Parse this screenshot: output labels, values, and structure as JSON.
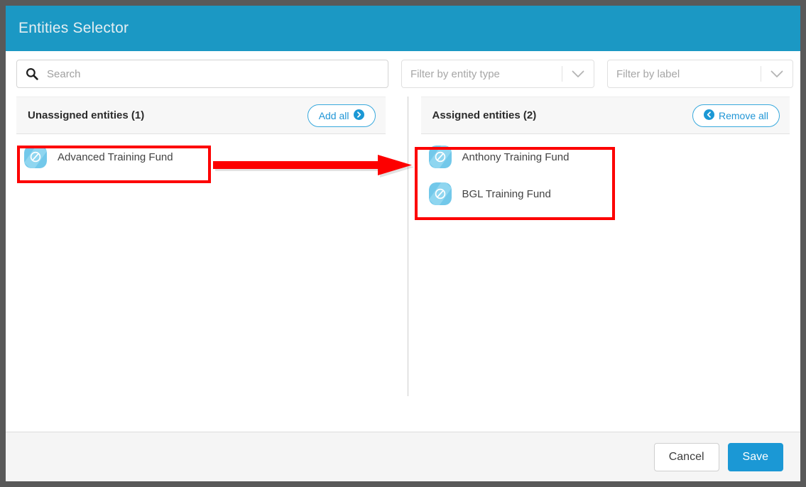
{
  "window": {
    "title": "Entities Selector"
  },
  "search": {
    "placeholder": "Search",
    "value": "",
    "icon": "search-icon"
  },
  "filters": [
    {
      "name": "entity-type",
      "placeholder": "Filter by entity type",
      "icon": "chevron-down-icon"
    },
    {
      "name": "label",
      "placeholder": "Filter by label",
      "icon": "chevron-down-icon"
    }
  ],
  "panels": {
    "unassigned": {
      "title": "Unassigned entities (1)",
      "action_label": "Add all",
      "action_icon": "circle-arrow-right-icon",
      "items": [
        {
          "name": "Advanced Training Fund",
          "icon": "fund-entity-icon"
        }
      ]
    },
    "assigned": {
      "title": "Assigned entities (2)",
      "action_label": "Remove all",
      "action_icon": "circle-arrow-left-icon",
      "items": [
        {
          "name": "Anthony Training Fund",
          "icon": "fund-entity-icon"
        },
        {
          "name": "BGL Training Fund",
          "icon": "fund-entity-icon"
        }
      ]
    }
  },
  "footer": {
    "cancel_label": "Cancel",
    "save_label": "Save"
  },
  "colors": {
    "title_bar": "#1b98c4",
    "accent": "#1b98d5",
    "annotation": "#fd0000",
    "entity_icon": "#72c8ea",
    "page_background": "#595959",
    "panel_header": "#f7f7f7",
    "footer": "#f5f5f5"
  }
}
